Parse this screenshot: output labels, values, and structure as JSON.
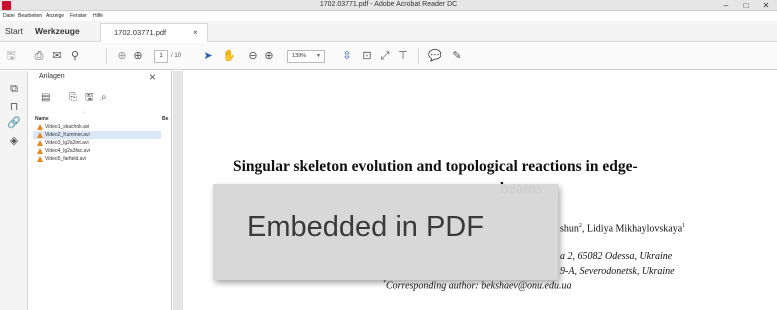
{
  "window": {
    "title": "1702.03771.pdf - Adobe Acrobat Reader DC"
  },
  "menu": [
    "Datei",
    "Bearbeiten",
    "Anzeige",
    "Fenster",
    "Hilfe"
  ],
  "tabs": {
    "start": "Start",
    "tools": "Werkzeuge",
    "document": "1702.03771.pdf",
    "close": "×"
  },
  "toolbar": {
    "page_current": "1",
    "page_total": "/ 10",
    "zoom": "139%"
  },
  "panel": {
    "title": "Anlagen",
    "close": "×",
    "col_name": "Name",
    "col_sort": "ˆ",
    "col_desc": "Be",
    "files": [
      {
        "name": "Video1_skachok.avi",
        "selected": false
      },
      {
        "name": "Video2_Kummer.avi",
        "selected": true
      },
      {
        "name": "Video3_lg2a3int.avi",
        "selected": false
      },
      {
        "name": "Video4_lg2a3fac.avi",
        "selected": false
      },
      {
        "name": "Video5_farfield.avi",
        "selected": false
      }
    ]
  },
  "paper": {
    "title_line1": "Singular skeleton evolution and topological reactions in edge-",
    "title_line2_visible": "beams",
    "authors_fragment": "shun",
    "authors_rest": ", Lidiya Mikhaylovskaya",
    "affil1": "a 2, 65082 Odessa, Ukraine",
    "affil2": "9-A, Severodonetsk, Ukraine",
    "corresponding": "Corresponding author: bekshaev@onu.edu.ua",
    "sup1": "2",
    "sup2": "1",
    "sup_star": "*"
  },
  "overlay": {
    "label": "Embedded in PDF"
  },
  "icons": {
    "app": "acrobat-icon",
    "minimize": "minimize-icon",
    "maximize": "maximize-icon",
    "close": "close-icon",
    "save": "save-icon",
    "print": "print-icon",
    "email": "email-icon",
    "search": "search-icon",
    "prev": "page-up-icon",
    "next": "page-down-icon",
    "select": "cursor-icon",
    "hand": "hand-icon",
    "zoom_out": "zoom-out-icon",
    "zoom_in": "zoom-in-icon"
  }
}
